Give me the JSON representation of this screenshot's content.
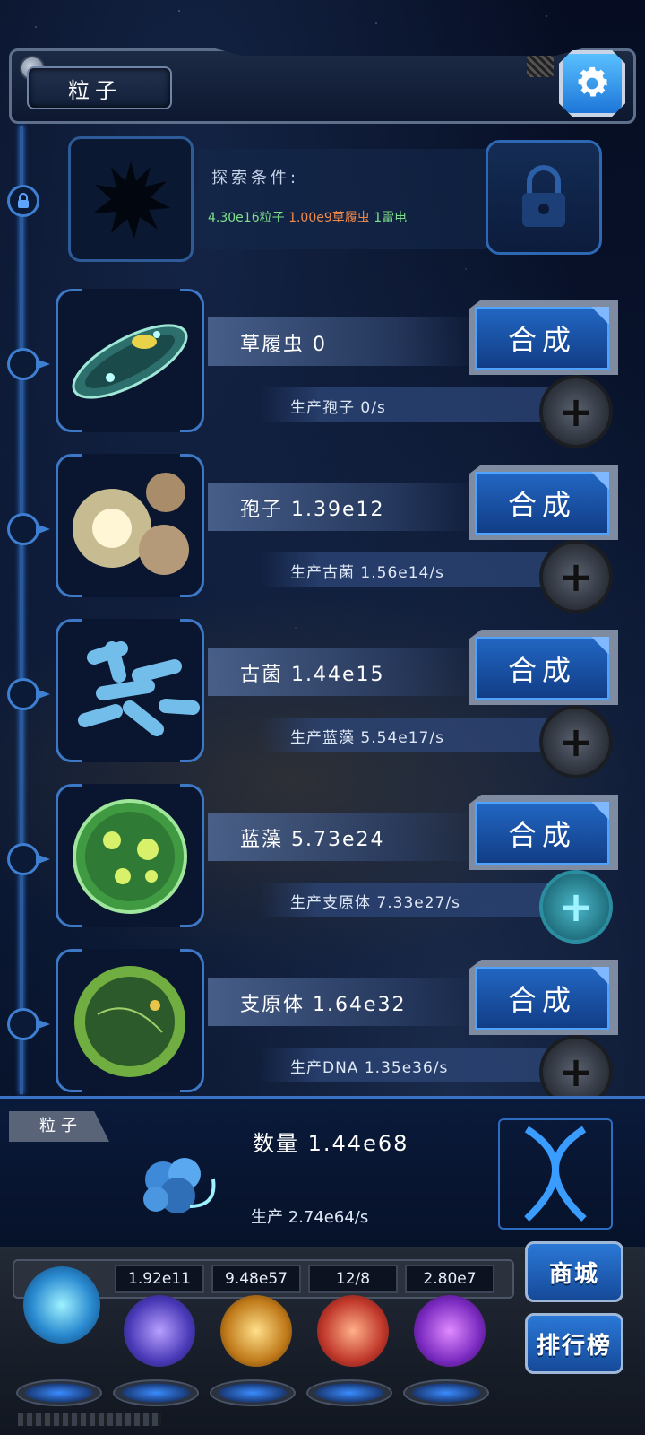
{
  "header": {
    "title": "粒子",
    "settings_icon": "gear-icon"
  },
  "locked": {
    "condition_label": "探索条件:",
    "requirements": [
      {
        "text": "4.30e16粒子",
        "color": "#7fe08a"
      },
      {
        "text": "1.00e9草履虫",
        "color": "#f08a4b"
      },
      {
        "text": "1雷电",
        "color": "#7fe08a"
      }
    ]
  },
  "units": [
    {
      "name": "草履虫 0",
      "production": "生产孢子 0/s",
      "synth_label": "合成",
      "upgrade_active": false
    },
    {
      "name": "孢子 1.39e12",
      "production": "生产古菌 1.56e14/s",
      "synth_label": "合成",
      "upgrade_active": false
    },
    {
      "name": "古菌 1.44e15",
      "production": "生产蓝藻 5.54e17/s",
      "synth_label": "合成",
      "upgrade_active": false
    },
    {
      "name": "蓝藻 5.73e24",
      "production": "生产支原体 7.33e27/s",
      "synth_label": "合成",
      "upgrade_active": true
    },
    {
      "name": "支原体 1.64e32",
      "production": "生产DNA 1.35e36/s",
      "synth_label": "合成",
      "upgrade_active": false
    }
  ],
  "summary": {
    "tag": "粒子",
    "quantity": "数量 1.44e68",
    "production": "生产 2.74e64/s"
  },
  "resources": [
    "1.92e11",
    "9.48e57",
    "12/8",
    "2.80e7"
  ],
  "side_buttons": {
    "shop": "商城",
    "ranking": "排行榜"
  },
  "colors": {
    "accent": "#2166c2",
    "frame": "#3c78c6",
    "active_plus": "#4ab8c8"
  }
}
